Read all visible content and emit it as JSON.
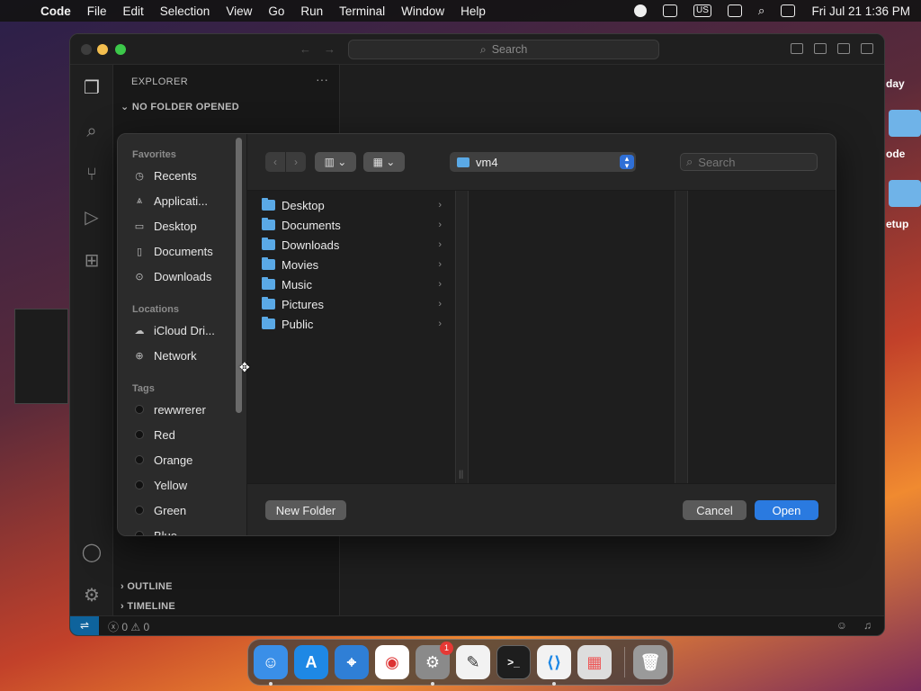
{
  "menubar": {
    "app_name": "Code",
    "items": [
      "File",
      "Edit",
      "Selection",
      "View",
      "Go",
      "Run",
      "Terminal",
      "Window",
      "Help"
    ],
    "input_source": "US",
    "datetime": "Fri Jul 21  1:36 PM"
  },
  "desktop": {
    "labels": [
      "day",
      "ode",
      "etup"
    ]
  },
  "vscode": {
    "command_center_placeholder": "Search",
    "explorer_title": "EXPLORER",
    "no_folder_section": "NO FOLDER OPENED",
    "outline_section": "OUTLINE",
    "timeline_section": "TIMELINE",
    "status_errors": "0",
    "status_warnings": "0"
  },
  "dialog": {
    "sidebar": {
      "favorites_heading": "Favorites",
      "favorites": [
        {
          "label": "Recents",
          "icon": "clock-icon"
        },
        {
          "label": "Applicati...",
          "icon": "applications-icon"
        },
        {
          "label": "Desktop",
          "icon": "desktop-icon"
        },
        {
          "label": "Documents",
          "icon": "document-icon"
        },
        {
          "label": "Downloads",
          "icon": "download-icon"
        }
      ],
      "locations_heading": "Locations",
      "locations": [
        {
          "label": "iCloud Dri...",
          "icon": "cloud-icon"
        },
        {
          "label": "Network",
          "icon": "globe-icon"
        }
      ],
      "tags_heading": "Tags",
      "tags": [
        "rewwrerer",
        "Red",
        "Orange",
        "Yellow",
        "Green",
        "Blue"
      ]
    },
    "current_folder": "vm4",
    "search_placeholder": "Search",
    "folders": [
      "Desktop",
      "Documents",
      "Downloads",
      "Movies",
      "Music",
      "Pictures",
      "Public"
    ],
    "new_folder_label": "New Folder",
    "cancel_label": "Cancel",
    "open_label": "Open"
  },
  "dock": {
    "apps": [
      {
        "name": "Finder",
        "icon": "finder-icon",
        "color": "#3a8fe8",
        "running": true
      },
      {
        "name": "App Store",
        "icon": "app-store-icon",
        "color": "#1e88e5",
        "running": false
      },
      {
        "name": "Safari",
        "icon": "safari-icon",
        "color": "#2f7fd6",
        "running": false
      },
      {
        "name": "Chrome",
        "icon": "chrome-icon",
        "color": "#ffffff",
        "running": false
      },
      {
        "name": "System Settings",
        "icon": "settings-icon",
        "color": "#8a8a8a",
        "running": true,
        "badge": "1"
      },
      {
        "name": "TextEdit",
        "icon": "textedit-icon",
        "color": "#f2f2f2",
        "running": false
      },
      {
        "name": "Terminal",
        "icon": "terminal-icon",
        "color": "#1e1e1e",
        "running": false
      },
      {
        "name": "VS Code",
        "icon": "vscode-icon",
        "color": "#f2f2f2",
        "running": true
      },
      {
        "name": "Launchpad",
        "icon": "launchpad-icon",
        "color": "#dddddd",
        "running": false
      },
      {
        "name": "Trash",
        "icon": "trash-icon",
        "color": "#9a9a9a",
        "running": false
      }
    ]
  }
}
